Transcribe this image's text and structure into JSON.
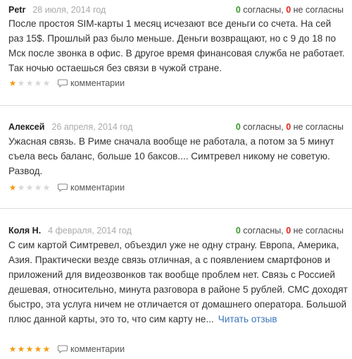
{
  "reviews": [
    {
      "author": "Petr",
      "date": "28 июля, 2014 год",
      "agree_count": "0",
      "agree_label": "согласны,",
      "disagree_count": "0",
      "disagree_label": "не согласны",
      "text": "После простоя SIM-карты 1 месяц исчезают все деньги со счета. На сей раз 15$. Прошлый раз было меньше. Деньги возвращают, но с 9 до 18 по Мск после звонка в офис. В другое время финансовая служба не работает. Так ночью остаешься без связи в чужой стране.",
      "rating": 1,
      "comments_label": "комментарии"
    },
    {
      "author": "Алексей",
      "date": "26 апреля, 2014 год",
      "agree_count": "0",
      "agree_label": "согласны,",
      "disagree_count": "0",
      "disagree_label": "не согласны",
      "text": "Ужасная связь. В Риме сначала вообще не работала, а потом за 5 минут съела весь баланс, больше 10 баксов.... Симтревел никому не советую. Развод.",
      "rating": 1,
      "comments_label": "комментарии"
    },
    {
      "author": "Коля Н.",
      "date": "4 февраля, 2014 год",
      "agree_count": "0",
      "agree_label": "согласны,",
      "disagree_count": "0",
      "disagree_label": "не согласны",
      "text": "С сим картой Симтревел, объездил уже не одну страну. Европа, Америка, Азия. Практически везде связь отличная, а с появлением смартфонов и приложений для видеозвонков так вообще проблем нет. Связь с Россией дешевая, относительно, минута разговора в районе 5 рублей. СМС доходят быстро, эта услуга ничем не отличается от домашнего оператора. Большой плюс данной карты, это то, что сим карту не...",
      "read_more": "Читать отзыв",
      "rating": 5,
      "comments_label": "комментарии"
    }
  ],
  "rating_max": 5,
  "colors": {
    "agree": "#3a9a2a",
    "disagree": "#e0231d",
    "star_on": "#f39c12",
    "star_off": "#d7d7d7",
    "link": "#3a76b8"
  },
  "icons": {
    "star": "star-icon",
    "comment": "comment-icon"
  }
}
